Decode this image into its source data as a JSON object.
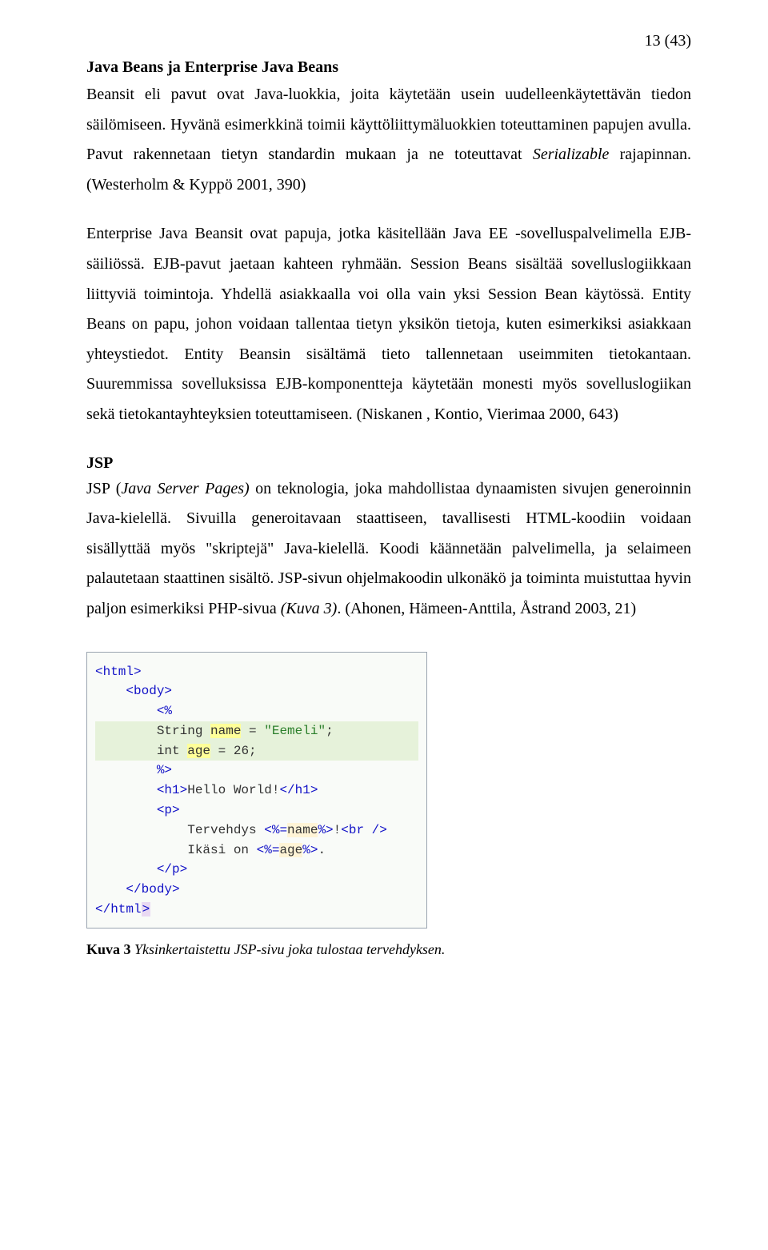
{
  "pageNumber": "13 (43)",
  "heading1": "Java Beans ja Enterprise Java Beans",
  "para1": "Beansit eli pavut ovat Java-luokkia, joita käytetään usein uudelleenkäytettävän tiedon säilömiseen. Hyvänä esimerkkinä toimii käyttöliittymäluokkien toteuttaminen papujen avulla. Pavut rakennetaan tietyn standardin mukaan ja ne toteuttavat ",
  "para1_italic": "Serializable",
  "para1_tail": " rajapinnan. (Westerholm & Kyppö 2001, 390)",
  "para2": "Enterprise Java Beansit ovat papuja, jotka käsitellään Java EE -sovelluspalvelimella EJB-säiliössä. EJB-pavut jaetaan kahteen ryhmään. Session Beans sisältää sovelluslogiikkaan liittyviä toimintoja. Yhdellä asiakkaalla voi olla vain yksi Session Bean käytössä. Entity Beans on papu, johon voidaan tallentaa tietyn yksikön tietoja, kuten esimerkiksi asiakkaan yhteystiedot. Entity Beansin sisältämä tieto tallennetaan useimmiten tietokantaan. Suuremmissa sovelluksissa EJB-komponentteja käytetään monesti myös sovelluslogiikan sekä tietokantayhteyksien toteuttamiseen. (Niskanen , Kontio, Vierimaa 2000, 643)",
  "heading2": "JSP",
  "para3_pre": "JSP (",
  "para3_italic1": "Java Server Pages)",
  "para3_mid": " on teknologia, joka mahdollistaa dynaamisten sivujen generoinnin Java-kielellä. Sivuilla generoitavaan staattiseen, tavallisesti HTML-koodiin voidaan sisällyttää myös \"skriptejä\" Java-kielellä. Koodi käännetään palvelimella, ja selaimeen palautetaan staattinen sisältö. JSP-sivun ohjelmakoodin ulkonäkö ja toiminta muistuttaa hyvin paljon esimerkiksi PHP-sivua ",
  "para3_italic2": "(Kuva 3)",
  "para3_tail": ". (Ahonen, Hämeen-Anttila, Åstrand 2003, 21)",
  "code": {
    "l1": "<html>",
    "l2": "    <body>",
    "l3": "        <%",
    "l4_pre": "        String ",
    "l4_name": "name",
    "l4_mid": " = ",
    "l4_str": "\"Eemeli\"",
    "l4_end": ";",
    "l5_pre": "        int ",
    "l5_age": "age",
    "l5_end": " = 26;",
    "l6": "        %>",
    "l7_open": "        <h1>",
    "l7_text": "Hello World!",
    "l7_close": "</h1>",
    "l8": "        <p>",
    "l9_t1": "            Tervehdys ",
    "l9_sc1": "<%=",
    "l9_v1": "name",
    "l9_sc2": "%>",
    "l9_t2": "!",
    "l9_br": "<br />",
    "l10_t1": "            Ikäsi on ",
    "l10_sc1": "<%=",
    "l10_v1": "age",
    "l10_sc2": "%>",
    "l10_t2": ".",
    "l11": "        </p>",
    "l12": "    </body>",
    "l13_a": "</html",
    "l13_b": ">"
  },
  "caption_bold": "Kuva 3",
  "caption_italic": " Yksinkertaistettu JSP-sivu joka tulostaa tervehdyksen."
}
